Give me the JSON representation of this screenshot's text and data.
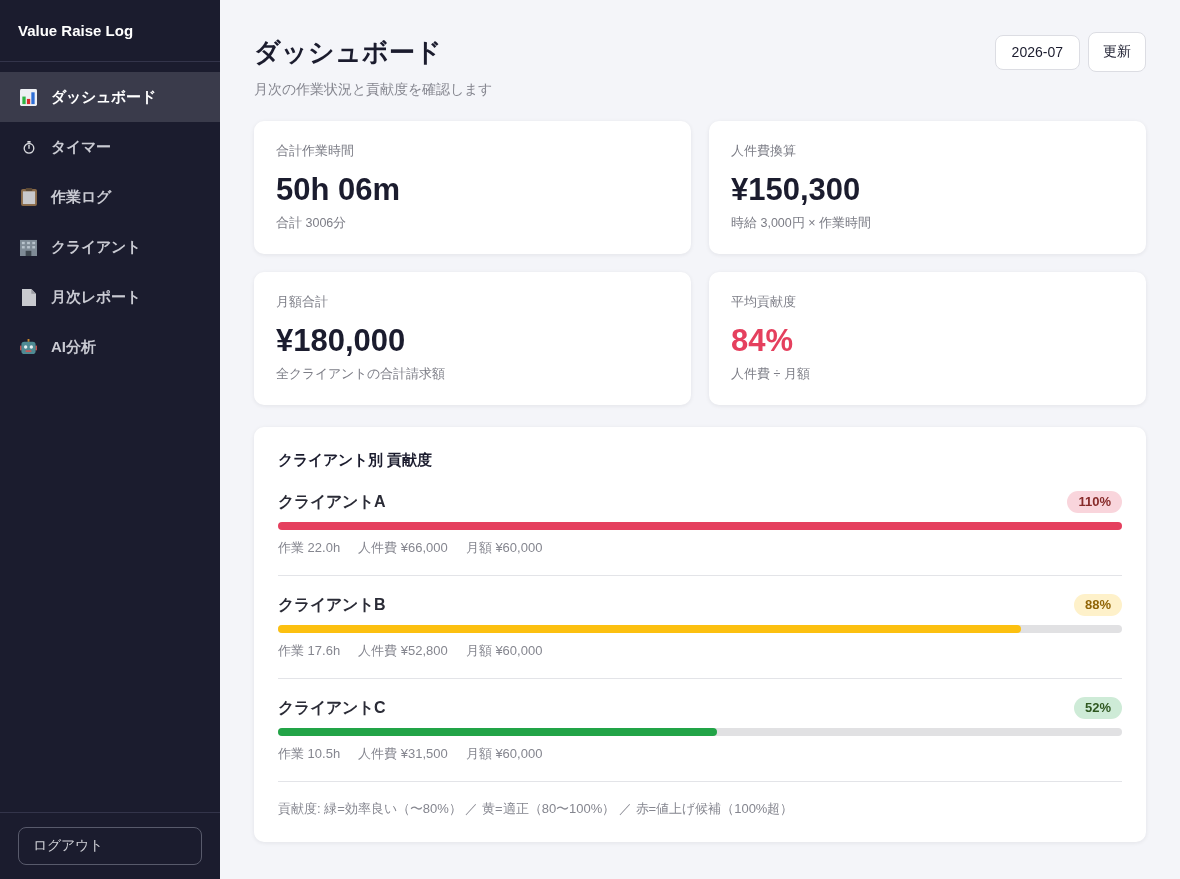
{
  "sidebar": {
    "app_name": "Value Raise Log",
    "items": [
      {
        "label": "ダッシュボード",
        "selected": true
      },
      {
        "label": "タイマー",
        "selected": false
      },
      {
        "label": "作業ログ",
        "selected": false
      },
      {
        "label": "クライアント",
        "selected": false
      },
      {
        "label": "月次レポート",
        "selected": false
      },
      {
        "label": "AI分析",
        "selected": false
      }
    ],
    "logout_button": "ログアウト"
  },
  "header": {
    "title": "ダッシュボード",
    "subtitle": "月次の作業状況と貢献度を確認します",
    "month_field": {
      "value": "2026-07"
    },
    "refresh_button": "更新"
  },
  "summary_cards": [
    {
      "label": "合計作業時間",
      "value": "50h 06m",
      "note": "合計 3006分",
      "color": "#1b1c2e"
    },
    {
      "label": "人件費換算",
      "value": "¥150,300",
      "note": "時給 3,000円 × 作業時間",
      "color": "#1b1c2e"
    },
    {
      "label": "月額合計",
      "value": "¥180,000",
      "note": "全クライアントの合計請求額",
      "color": "#1b1c2e"
    },
    {
      "label": "平均貢献度",
      "value": "84%",
      "note": "人件費 ÷ 月額",
      "color": "#e5405e"
    }
  ],
  "contribution": {
    "title": "クライアント別 貢献度",
    "clients": [
      {
        "name": "クライアントA",
        "percent": "110%",
        "level": 1,
        "color": "#e5405e",
        "hours": "作業 22.0h",
        "labor_cost": "人件費 ¥66,000",
        "monthly_fee": "月額 ¥60,000"
      },
      {
        "name": "クライアントB",
        "percent": "88%",
        "level": 0.88,
        "color": "#fcc010",
        "hours": "作業 17.6h",
        "labor_cost": "人件費 ¥52,800",
        "monthly_fee": "月額 ¥60,000"
      },
      {
        "name": "クライアントC",
        "percent": "52%",
        "level": 0.52,
        "color": "#22a447",
        "hours": "作業 10.5h",
        "labor_cost": "人件費 ¥31,500",
        "monthly_fee": "月額 ¥60,000"
      }
    ],
    "legend": "貢献度: 緑=効率良い（〜80%） ／ 黄=適正（80〜100%） ／ 赤=値上げ候補（100%超）"
  }
}
